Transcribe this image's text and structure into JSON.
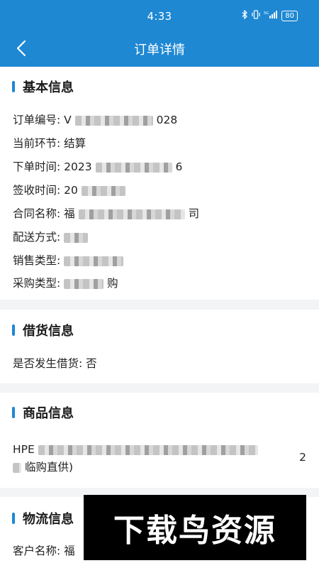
{
  "status": {
    "time": "4:33",
    "battery": "80"
  },
  "header": {
    "title": "订单详情"
  },
  "sections": {
    "basic": {
      "title": "基本信息",
      "rows": [
        {
          "label": "订单编号:",
          "value_start": "V",
          "value_end": "028"
        },
        {
          "label": "当前环节:",
          "value_start": "结算",
          "value_end": ""
        },
        {
          "label": "下单时间:",
          "value_start": "2023",
          "value_end": "6"
        },
        {
          "label": "签收时间:",
          "value_start": "20",
          "value_end": ""
        },
        {
          "label": "合同名称:",
          "value_start": "福",
          "value_end": "司"
        },
        {
          "label": "配送方式:",
          "value_start": "",
          "value_end": ""
        },
        {
          "label": "销售类型:",
          "value_start": "",
          "value_end": ""
        },
        {
          "label": "采购类型:",
          "value_start": "",
          "value_end": "购"
        }
      ]
    },
    "loan": {
      "title": "借货信息",
      "row_label": "是否发生借货:",
      "row_value": "否"
    },
    "goods": {
      "title": "商品信息",
      "line1": "HPE",
      "line2": "临购直供)",
      "quantity": "2"
    },
    "logistics": {
      "title": "物流信息",
      "row_label": "客户名称:",
      "row_value": "福"
    }
  },
  "watermark": {
    "text": "下载鸟资源"
  }
}
